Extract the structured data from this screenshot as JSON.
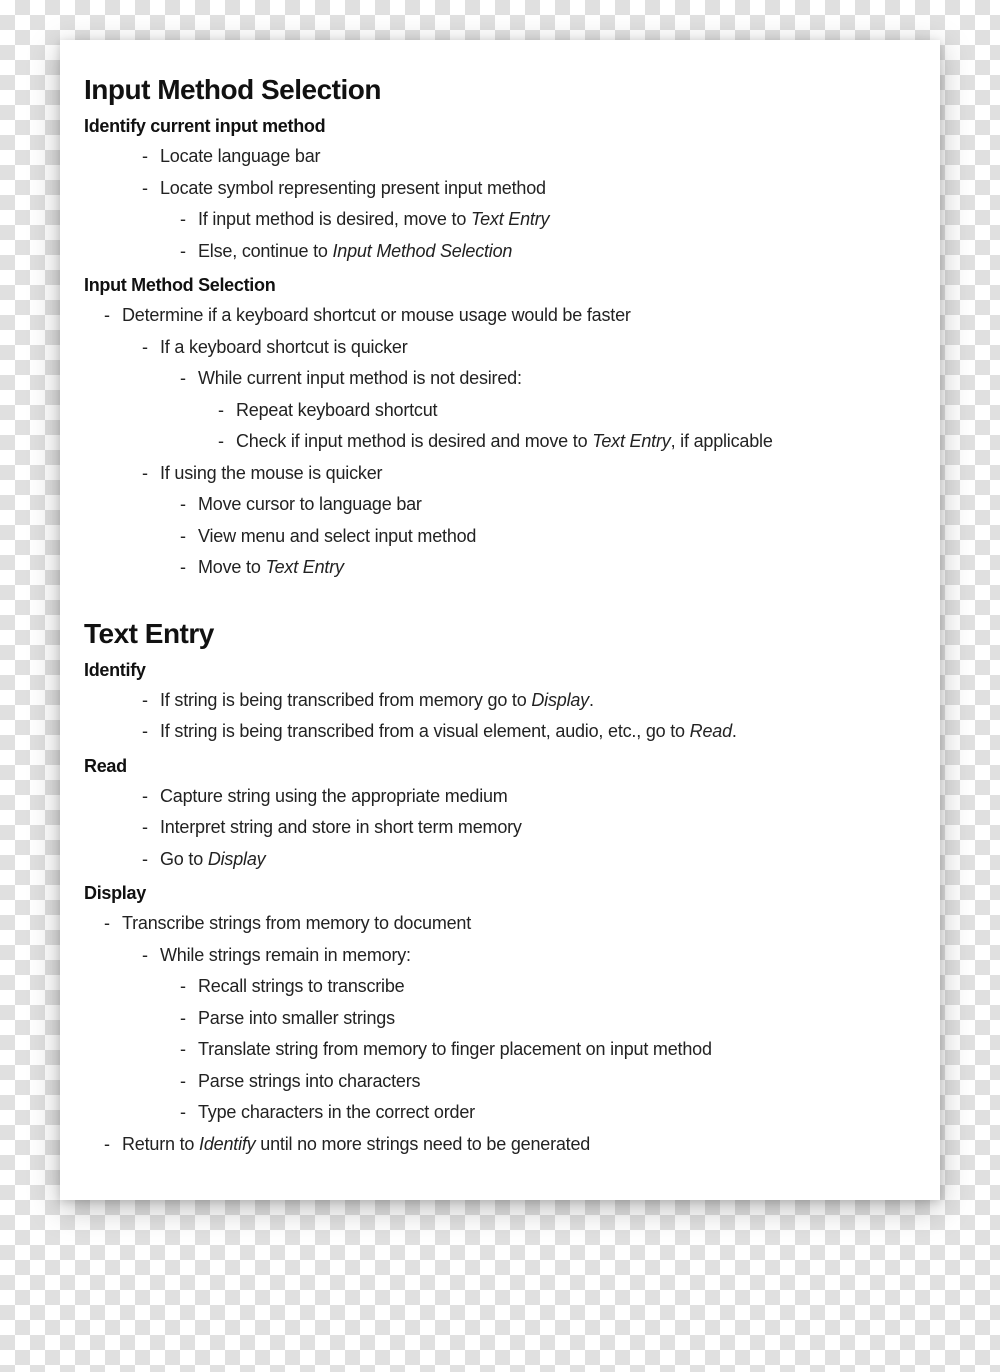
{
  "section1": {
    "title": "Input Method Selection",
    "sub1": "Identify current input method",
    "s1_l1": "Locate language bar",
    "s1_l2": "Locate symbol representing present input method",
    "s1_l2_a_pre": "If input method is desired, move to ",
    "s1_l2_a_em": "Text Entry",
    "s1_l2_b_pre": "Else, continue to ",
    "s1_l2_b_em": "Input Method Selection",
    "sub2": "Input Method Selection",
    "s2_l1": "Determine if a keyboard shortcut or mouse usage would be faster",
    "s2_l1_a": "If a keyboard shortcut is quicker",
    "s2_l1_a_i": "While current input method is not desired:",
    "s2_l1_a_i_1": "Repeat keyboard shortcut",
    "s2_l1_a_i_2_pre": "Check if input method is desired and move to ",
    "s2_l1_a_i_2_em": "Text Entry",
    "s2_l1_a_i_2_post": ", if applicable",
    "s2_l1_b": "If using the mouse is quicker",
    "s2_l1_b_i": "Move cursor to language bar",
    "s2_l1_b_ii": "View menu and select input method",
    "s2_l1_b_iii_pre": "Move to ",
    "s2_l1_b_iii_em": "Text Entry"
  },
  "section2": {
    "title": "Text Entry",
    "sub1": "Identify",
    "id_l1_pre": "If string is being transcribed from memory go to ",
    "id_l1_em": "Display",
    "id_l1_post": ".",
    "id_l2_pre": "If string is being transcribed from a visual element, audio, etc., go to ",
    "id_l2_em": "Read",
    "id_l2_post": ".",
    "sub2": "Read",
    "rd_l1": "Capture string using the appropriate medium",
    "rd_l2": "Interpret string and store in short term memory",
    "rd_l3_pre": "Go to ",
    "rd_l3_em": "Display",
    "sub3": "Display",
    "dp_l1": "Transcribe strings from memory to document",
    "dp_l1_a": "While strings remain in memory:",
    "dp_l1_a_i": "Recall strings to transcribe",
    "dp_l1_a_ii": "Parse into smaller strings",
    "dp_l1_a_iii": "Translate string from memory to finger placement on input method",
    "dp_l1_a_iv": "Parse strings into characters",
    "dp_l1_a_v": "Type characters in the correct order",
    "dp_l2_pre": "Return to ",
    "dp_l2_em": "Identify",
    "dp_l2_post": " until no more strings need to be generated"
  }
}
